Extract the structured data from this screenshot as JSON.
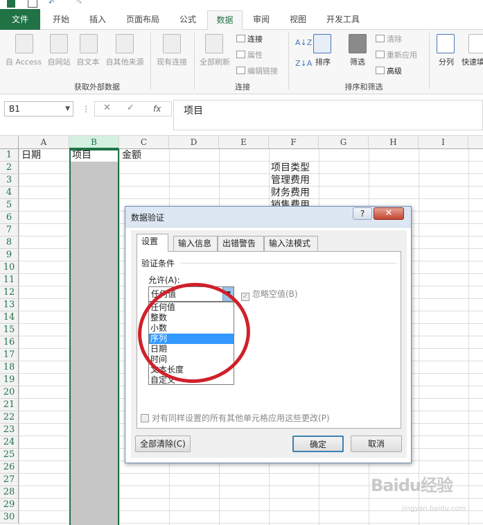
{
  "tabs": [
    "文件",
    "开始",
    "插入",
    "页面布局",
    "公式",
    "数据",
    "审阅",
    "视图",
    "开发工具"
  ],
  "active_tab": "数据",
  "ribbon": {
    "external": [
      "自 Access",
      "自网站",
      "自文本",
      "自其他来源",
      "现有连接"
    ],
    "refresh": "全部刷新",
    "conn_items": [
      "连接",
      "属性",
      "编辑链接"
    ],
    "sort_label": "排序",
    "filter_label": "筛选",
    "filter_items": [
      "清除",
      "重新应用",
      "高级"
    ],
    "split_label": "分列",
    "quick_label": "快速填",
    "groups": [
      "获取外部数据",
      "连接",
      "排序和筛选"
    ]
  },
  "formula_bar": {
    "name_box": "B1",
    "fx": "fx",
    "content": "项目"
  },
  "columns": [
    "A",
    "B",
    "C",
    "D",
    "E",
    "F",
    "G",
    "H",
    "I"
  ],
  "rows": [
    "1",
    "2",
    "3",
    "4",
    "5",
    "6",
    "7",
    "8",
    "9",
    "10",
    "11",
    "12",
    "13",
    "14",
    "15",
    "16",
    "17",
    "18",
    "19",
    "20",
    "21",
    "22",
    "23",
    "24",
    "25",
    "26",
    "27",
    "28",
    "29",
    "30"
  ],
  "cells": {
    "A1": "日期",
    "B1": "项目",
    "C1": "金额",
    "F2": "项目类型",
    "F3": "管理费用",
    "F4": "财务费用",
    "F5": "销售费用"
  },
  "dialog": {
    "title": "数据验证",
    "help": "?",
    "close": "✕",
    "tabs": [
      "设置",
      "输入信息",
      "出错警告",
      "输入法模式"
    ],
    "criteria_label": "验证条件",
    "allow_label": "允许(A):",
    "allow_value": "任何值",
    "options": [
      "任何值",
      "整数",
      "小数",
      "序列",
      "日期",
      "时间",
      "文本长度",
      "自定义"
    ],
    "highlighted_option": "序列",
    "ignore_blank": "忽略空值(B)",
    "apply_all": "对有同样设置的所有其他单元格应用这些更改(P)",
    "clear_all": "全部清除(C)",
    "ok": "确定",
    "cancel": "取消"
  },
  "watermark": {
    "line1": "Baidu经验",
    "line2": "jingyan.baidu.com"
  },
  "colors": {
    "excel_green": "#217346",
    "highlight": "#3399ff",
    "annotation_red": "#d0202a"
  }
}
